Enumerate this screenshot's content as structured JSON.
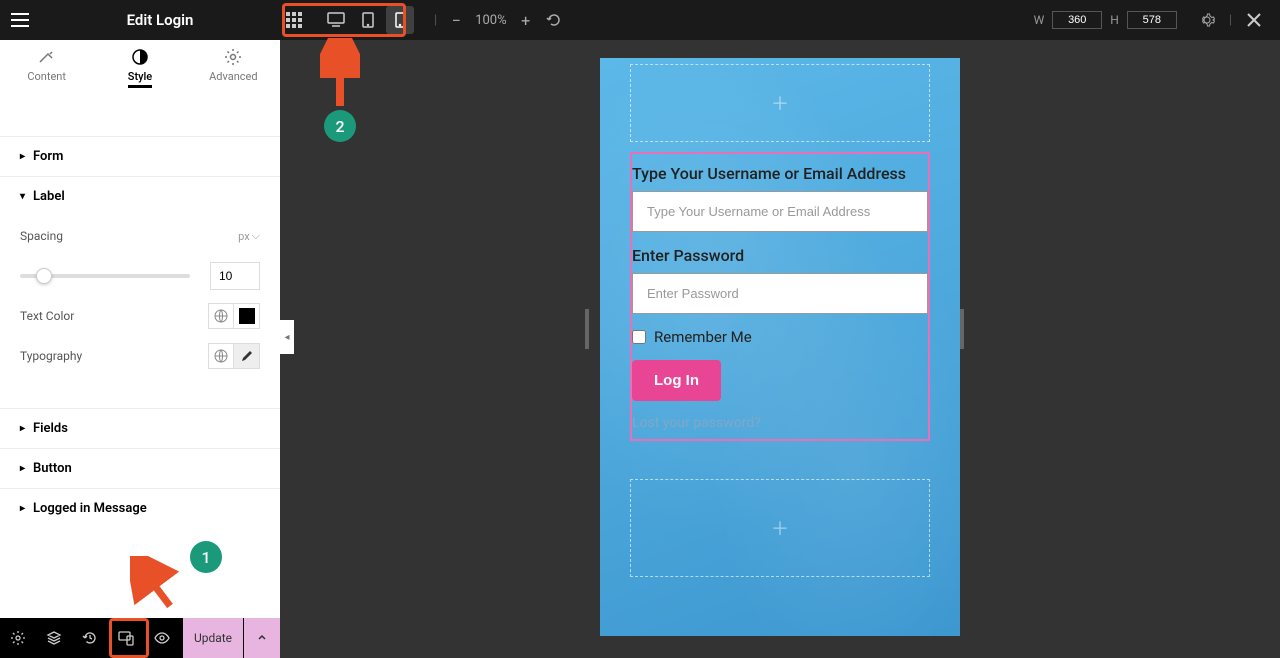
{
  "header": {
    "title": "Edit Login",
    "zoom": "100%",
    "width_label": "W",
    "width_value": "360",
    "height_label": "H",
    "height_value": "578"
  },
  "tabs": {
    "content": "Content",
    "style": "Style",
    "advanced": "Advanced"
  },
  "sections": {
    "form": "Form",
    "label": "Label",
    "fields": "Fields",
    "button": "Button",
    "logged_in": "Logged in Message"
  },
  "controls": {
    "spacing_label": "Spacing",
    "spacing_unit": "px",
    "spacing_value": "10",
    "text_color_label": "Text Color",
    "typography_label": "Typography"
  },
  "bottom": {
    "update": "Update"
  },
  "form": {
    "username_label": "Type Your Username or Email Address",
    "username_placeholder": "Type Your Username or Email Address",
    "password_label": "Enter Password",
    "password_placeholder": "Enter Password",
    "remember": "Remember Me",
    "submit": "Log In",
    "lost": "Lost your password?"
  },
  "annotations": {
    "badge1": "1",
    "badge2": "2"
  }
}
